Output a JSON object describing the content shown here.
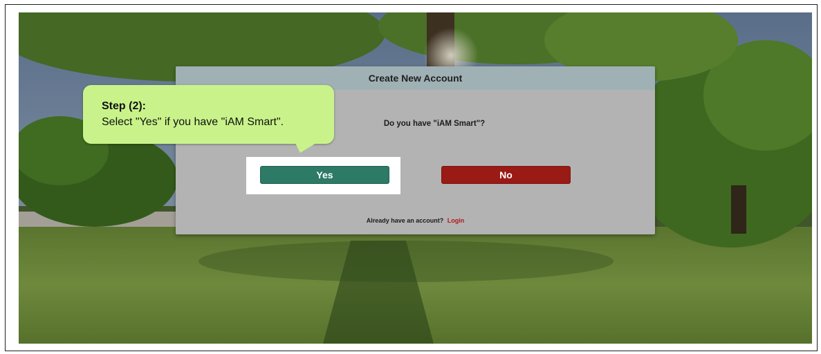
{
  "callout": {
    "title": "Step (2):",
    "text": "Select \"Yes\" if you have \"iAM Smart\"."
  },
  "dialog": {
    "title": "Create New Account",
    "question": "Do you have \"iAM Smart\"?",
    "yes_label": "Yes",
    "no_label": "No",
    "login_prompt": "Already have an account?",
    "login_link": "Login"
  },
  "colors": {
    "yes_button": "#2d7a66",
    "no_button": "#9a1a15",
    "callout_bg": "#c9f38a",
    "header_bg": "#9fb1b4",
    "dialog_bg": "#b3b3b3",
    "link": "#b01a1a"
  }
}
